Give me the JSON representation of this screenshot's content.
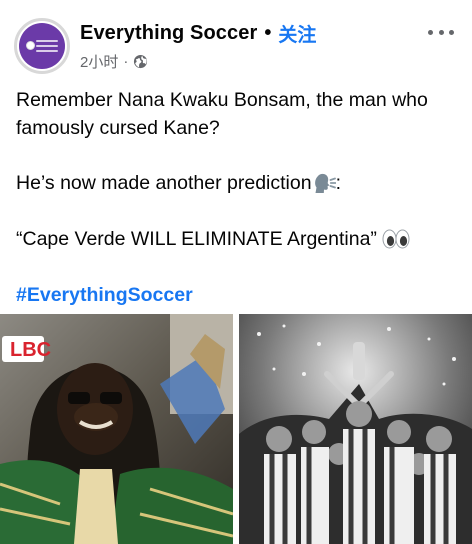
{
  "post": {
    "page_name": "Everything Soccer",
    "separator": "•",
    "follow_label": "关注",
    "timestamp": "2小时",
    "meta_separator": "·",
    "audience_icon": "globe-icon",
    "more_icon": "more-horizontal-icon",
    "avatar_icon": "everything-soccer-logo"
  },
  "body": {
    "line1": "Remember Nana Kwaku Bonsam, the man who famously cursed Kane?",
    "line2": "He’s now made another prediction",
    "line2_suffix": ":",
    "line2_emoji": "speaking-head-icon",
    "line3": "“Cape Verde WILL ELIMINATE Argentina”",
    "line3_emoji": "eyes-icon",
    "hashtag": "#EverythingSoccer"
  },
  "media": {
    "left_logo": "LBC",
    "left_image": "man-with-dreadlocks-photo",
    "right_image": "argentina-team-celebrating-trophy-photo"
  },
  "colors": {
    "accent": "#1877f2",
    "text": "#050505",
    "secondary": "#65676b",
    "avatar": "#6b3aa8",
    "lbc_red": "#d9232e"
  }
}
